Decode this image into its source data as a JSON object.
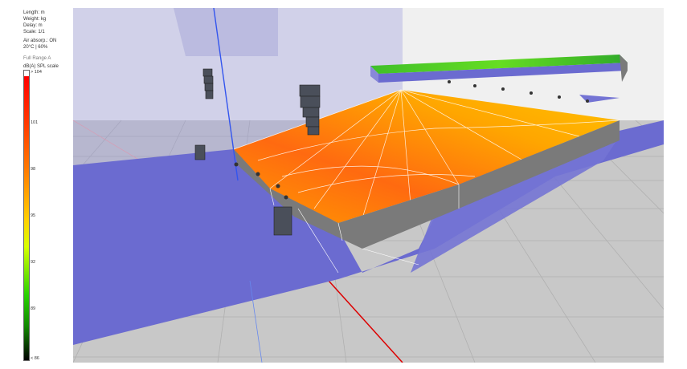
{
  "units": {
    "length": "Length: m",
    "weight": "Weight: kg",
    "delay": "Delay: m",
    "scale": "Scale: 1/1"
  },
  "environment": {
    "air_absorption": "Air absorp.: ON",
    "temperature_humidity": "20°C | 60%"
  },
  "mode_label": "Full Range A",
  "spl_scale": {
    "title": "dB(A) SPL scale",
    "ticks": [
      "> 104",
      "101",
      "98",
      "95",
      "92",
      "89",
      "< 86"
    ],
    "colors": [
      "#ff0000",
      "#ff7f00",
      "#ffd200",
      "#d8ff00",
      "#29d100",
      "#000000"
    ]
  }
}
